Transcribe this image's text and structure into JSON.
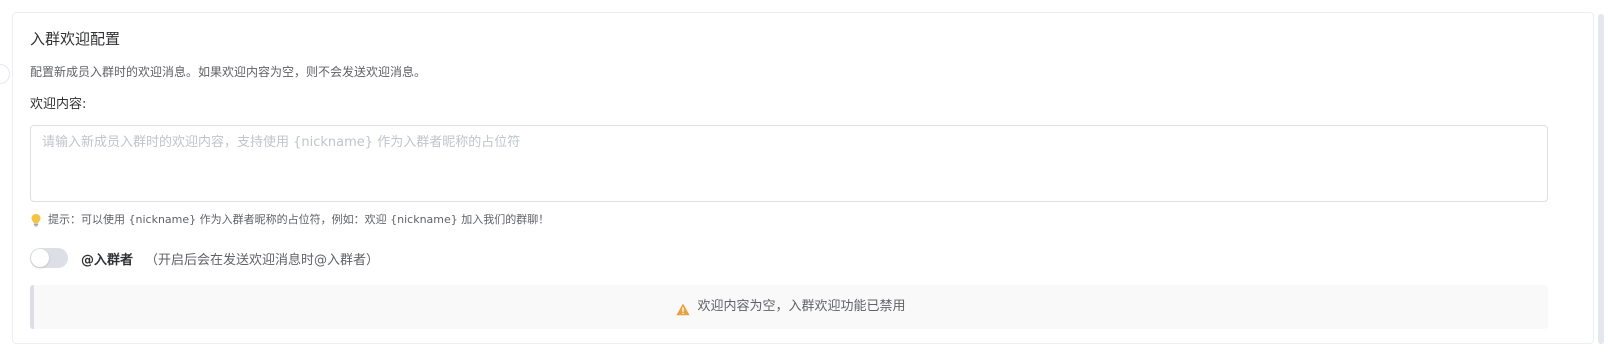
{
  "card": {
    "title": "入群欢迎配置",
    "description": "配置新成员入群时的欢迎消息。如果欢迎内容为空，则不会发送欢迎消息。"
  },
  "welcome_content": {
    "label": "欢迎内容:",
    "value": "",
    "placeholder": "请输入新成员入群时的欢迎内容，支持使用 {nickname} 作为入群者昵称的占位符"
  },
  "hint": {
    "icon": "lightbulb-icon",
    "text": "提示：可以使用 {nickname} 作为入群者昵称的占位符，例如：欢迎 {nickname} 加入我们的群聊！"
  },
  "mention_switch": {
    "enabled": false,
    "label": "@入群者",
    "note": "（开启后会在发送欢迎消息时@入群者）"
  },
  "status_notice": {
    "icon": "warning-icon",
    "text": "欢迎内容为空，入群欢迎功能已禁用"
  },
  "colors": {
    "border": "#dcdfe6",
    "text_primary": "#303133",
    "text_secondary": "#606266",
    "placeholder": "#c0c4cc",
    "warning": "#e6a23c",
    "notice_bg": "#f9f9f9"
  }
}
